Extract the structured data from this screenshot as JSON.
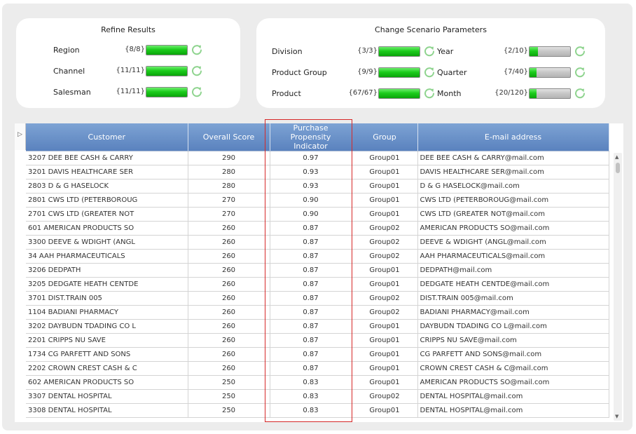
{
  "refine": {
    "title": "Refine Results",
    "filters": [
      {
        "label": "Region",
        "count": "{8/8}",
        "fill": 1.0
      },
      {
        "label": "Channel",
        "count": "{11/11}",
        "fill": 1.0
      },
      {
        "label": "Salesman",
        "count": "{11/11}",
        "fill": 1.0
      }
    ]
  },
  "scenario": {
    "title": "Change Scenario Parameters",
    "left_filters": [
      {
        "label": "Division",
        "count": "{3/3}",
        "fill": 1.0
      },
      {
        "label": "Product Group",
        "count": "{9/9}",
        "fill": 1.0
      },
      {
        "label": "Product",
        "count": "{67/67}",
        "fill": 1.0
      }
    ],
    "right_filters": [
      {
        "label": "Year",
        "count": "{2/10}",
        "fill": 0.2
      },
      {
        "label": "Quarter",
        "count": "{7/40}",
        "fill": 0.175
      },
      {
        "label": "Month",
        "count": "{20/120}",
        "fill": 0.167
      }
    ]
  },
  "colors": {
    "header_blue": "#6a91c8",
    "fill_green": "#1ccc1c",
    "highlight_red": "#d62828",
    "refresh_green": "#8fd48f"
  },
  "table": {
    "headers": {
      "customer": "Customer",
      "score": "Overall Score",
      "propensity": "Purchase Propensity Indicator",
      "group": "Group",
      "email": "E-mail address"
    },
    "rows": [
      {
        "customer": "3207 DEE BEE CASH & CARRY",
        "score": "290",
        "propensity": "0.97",
        "group": "Group01",
        "email": "DEE BEE CASH & CARRY@mail.com"
      },
      {
        "customer": "3201 DAVIS HEALTHCARE SER",
        "score": "280",
        "propensity": "0.93",
        "group": "Group01",
        "email": "DAVIS HEALTHCARE SER@mail.com"
      },
      {
        "customer": "2803 D & G HASELOCK",
        "score": "280",
        "propensity": "0.93",
        "group": "Group01",
        "email": "D & G HASELOCK@mail.com"
      },
      {
        "customer": "2801 CWS LTD (PETERBOROUG",
        "score": "270",
        "propensity": "0.90",
        "group": "Group01",
        "email": "CWS LTD (PETERBOROUG@mail.com"
      },
      {
        "customer": "2701 CWS LTD (GREATER NOT",
        "score": "270",
        "propensity": "0.90",
        "group": "Group01",
        "email": "CWS LTD (GREATER NOT@mail.com"
      },
      {
        "customer": "601 AMERICAN PRODUCTS SO",
        "score": "260",
        "propensity": "0.87",
        "group": "Group02",
        "email": "AMERICAN PRODUCTS SO@mail.com"
      },
      {
        "customer": "3300 DEEVE & WDIGHT (ANGL",
        "score": "260",
        "propensity": "0.87",
        "group": "Group02",
        "email": "DEEVE & WDIGHT (ANGL@mail.com"
      },
      {
        "customer": "34 AAH PHARMACEUTICALS",
        "score": "260",
        "propensity": "0.87",
        "group": "Group02",
        "email": "AAH PHARMACEUTICALS@mail.com"
      },
      {
        "customer": "3206 DEDPATH",
        "score": "260",
        "propensity": "0.87",
        "group": "Group01",
        "email": "DEDPATH@mail.com"
      },
      {
        "customer": "3205 DEDGATE HEATH CENTDE",
        "score": "260",
        "propensity": "0.87",
        "group": "Group01",
        "email": "DEDGATE HEATH CENTDE@mail.com"
      },
      {
        "customer": "3701 DIST.TRAIN 005",
        "score": "260",
        "propensity": "0.87",
        "group": "Group02",
        "email": "DIST.TRAIN 005@mail.com"
      },
      {
        "customer": "1104 BADIANI PHARMACY",
        "score": "260",
        "propensity": "0.87",
        "group": "Group02",
        "email": "BADIANI PHARMACY@mail.com"
      },
      {
        "customer": "3202 DAYBUDN TDADING CO L",
        "score": "260",
        "propensity": "0.87",
        "group": "Group01",
        "email": "DAYBUDN TDADING CO L@mail.com"
      },
      {
        "customer": "2201 CRIPPS NU SAVE",
        "score": "260",
        "propensity": "0.87",
        "group": "Group01",
        "email": "CRIPPS NU SAVE@mail.com"
      },
      {
        "customer": "1734 CG PARFETT AND SONS",
        "score": "260",
        "propensity": "0.87",
        "group": "Group01",
        "email": "CG PARFETT AND SONS@mail.com"
      },
      {
        "customer": "2202 CROWN CREST CASH & C",
        "score": "260",
        "propensity": "0.87",
        "group": "Group01",
        "email": "CROWN CREST CASH & C@mail.com"
      },
      {
        "customer": "602 AMERICAN PRODUCTS SO",
        "score": "250",
        "propensity": "0.83",
        "group": "Group01",
        "email": "AMERICAN PRODUCTS SO@mail.com"
      },
      {
        "customer": "3307 DENTAL HOSPITAL",
        "score": "250",
        "propensity": "0.83",
        "group": "Group02",
        "email": "DENTAL HOSPITAL@mail.com"
      },
      {
        "customer": "3308 DENTAL HOSPITAL",
        "score": "250",
        "propensity": "0.83",
        "group": "Group01",
        "email": "DENTAL HOSPITAL@mail.com"
      }
    ]
  }
}
